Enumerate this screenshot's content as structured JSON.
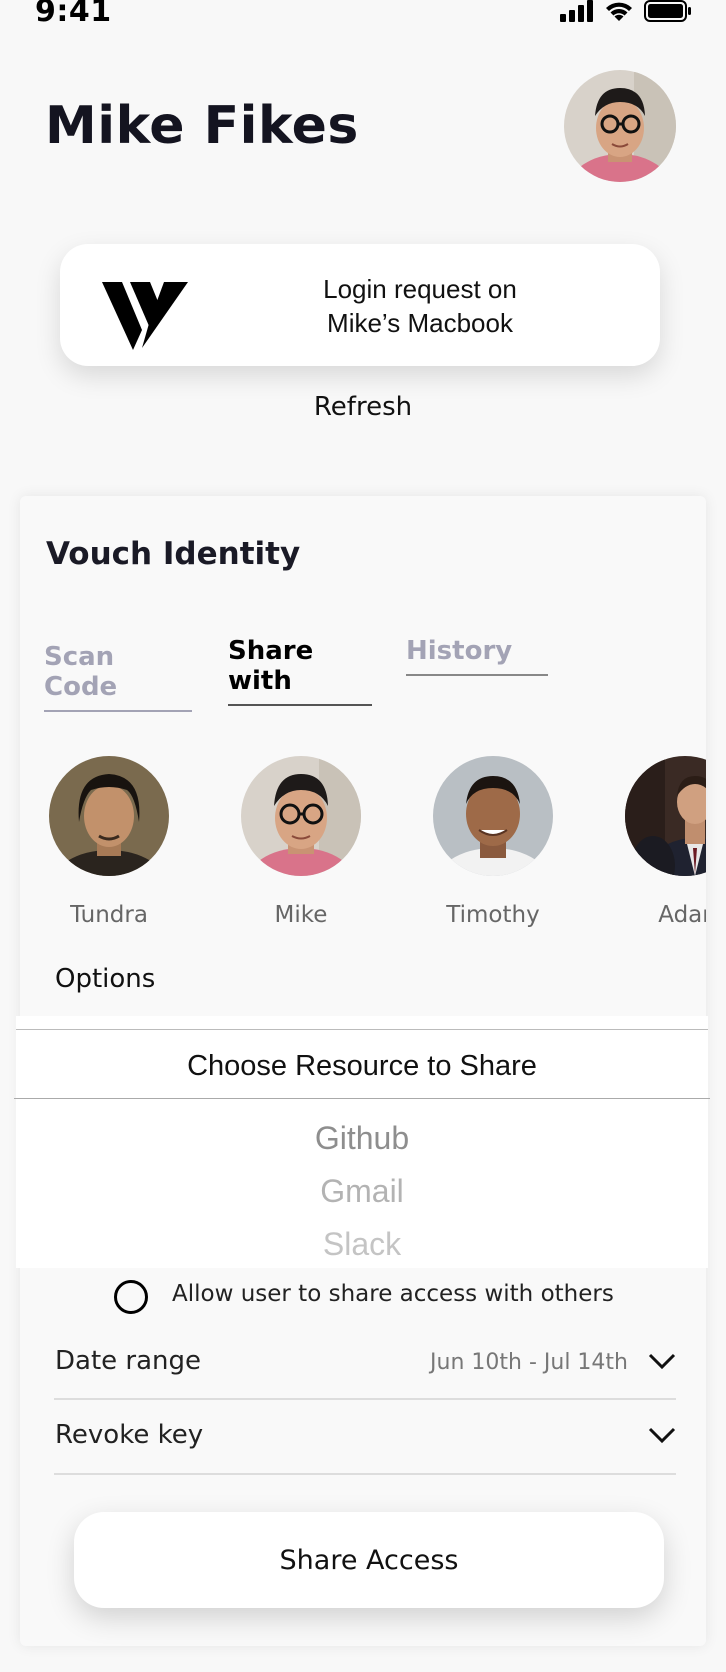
{
  "status": {
    "time": "9:41"
  },
  "header": {
    "title": "Mike Fikes"
  },
  "login_card": {
    "line1": "Login request on",
    "line2": "Mike’s Macbook"
  },
  "refresh_label": "Refresh",
  "panel": {
    "title": "Vouch Identity",
    "tabs": [
      {
        "label": "Scan Code"
      },
      {
        "label": "Share with"
      },
      {
        "label": "History"
      }
    ],
    "contacts": [
      {
        "name": "Tundra"
      },
      {
        "name": "Mike"
      },
      {
        "name": "Timothy"
      },
      {
        "name": "Adar"
      }
    ],
    "options_label": "Options",
    "picker": {
      "title": "Choose Resource to Share",
      "items": [
        "Github",
        "Gmail",
        "Slack"
      ]
    },
    "allow_share_label": "Allow user to share access with others",
    "date_range": {
      "label": "Date range",
      "value": "Jun 10th - Jul 14th"
    },
    "revoke_key": {
      "label": "Revoke key"
    },
    "share_button": "Share Access"
  },
  "icons": [
    "signal-icon",
    "wifi-icon",
    "battery-icon",
    "vouch-logo-icon",
    "chevron-down-icon"
  ]
}
